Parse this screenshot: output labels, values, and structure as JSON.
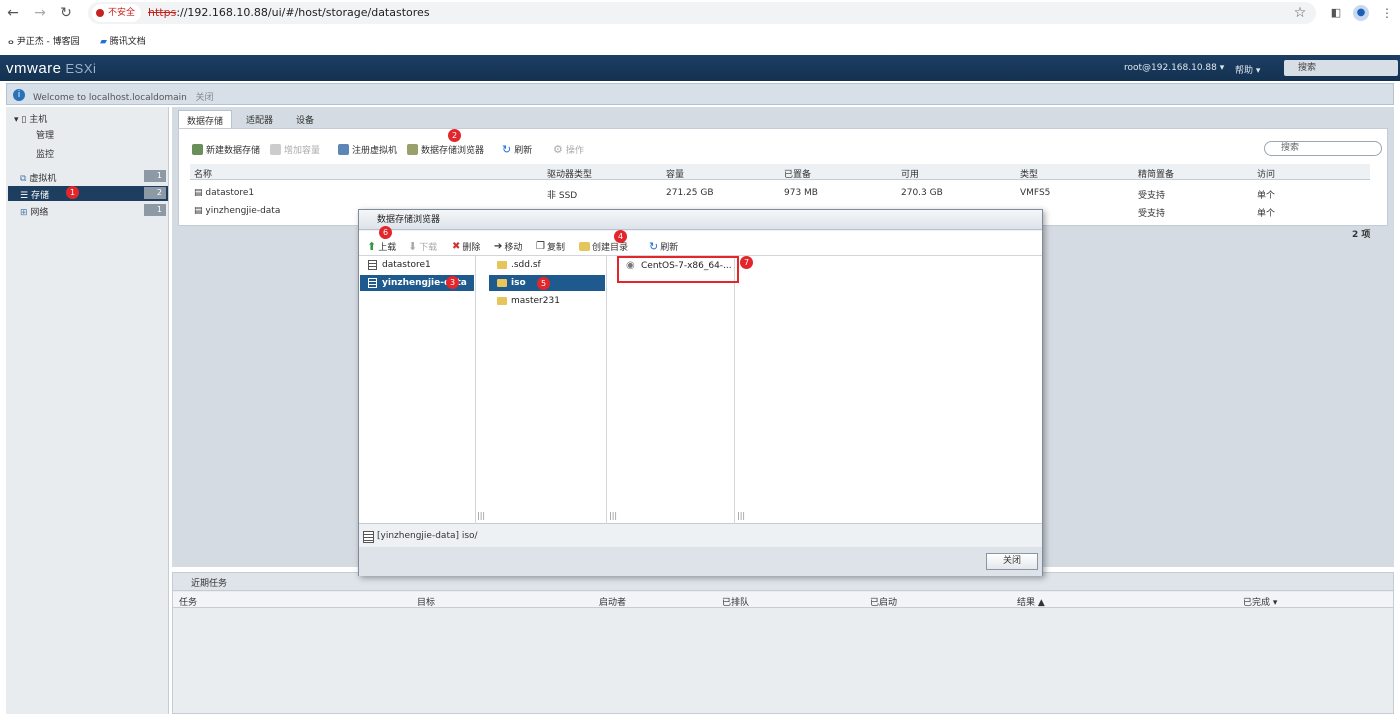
{
  "browser": {
    "insecure_label": "不安全",
    "url_scheme": "https",
    "url_rest": "://192.168.10.88/ui/#/host/storage/datastores",
    "bookmarks": [
      "尹正杰 - 博客园",
      "腾讯文档"
    ]
  },
  "esxi": {
    "logo_brand": "vmware",
    "logo_product": "ESXi",
    "user": "root@192.168.10.88 ▾",
    "help": "帮助 ▾",
    "search_placeholder": "搜索"
  },
  "welcome": {
    "text": "Welcome to localhost.localdomain",
    "dismiss": "关闭"
  },
  "sidebar": {
    "host": "主机",
    "manage": "管理",
    "monitor": "监控",
    "vms": {
      "label": "虚拟机",
      "count": "1"
    },
    "storage": {
      "label": "存储",
      "count": "2"
    },
    "network": {
      "label": "网络",
      "count": "1"
    }
  },
  "main": {
    "tabs": [
      "数据存储",
      "适配器",
      "设备"
    ],
    "toolbar": {
      "new": "新建数据存储",
      "increase": "增加容量",
      "register": "注册虚拟机",
      "browser": "数据存储浏览器",
      "refresh": "刷新",
      "actions": "操作"
    },
    "search_placeholder": "搜索",
    "columns": [
      "名称",
      "驱动器类型",
      "容量",
      "已置备",
      "可用",
      "类型",
      "精简置备",
      "访问"
    ],
    "rows": [
      [
        "datastore1",
        "非 SSD",
        "271.25 GB",
        "973 MB",
        "270.3 GB",
        "VMFS5",
        "受支持",
        "单个"
      ],
      [
        "yinzhengjie-data",
        "非 SSD",
        "",
        "",
        "",
        "VMFS5",
        "受支持",
        "单个"
      ]
    ],
    "items_count": "2 项"
  },
  "tasks": {
    "title": "近期任务",
    "columns": [
      "任务",
      "目标",
      "启动者",
      "已排队",
      "已启动",
      "结果 ▲",
      "已完成 ▾"
    ]
  },
  "dialog": {
    "title": "数据存储浏览器",
    "toolbar": {
      "upload": "上载",
      "download": "下载",
      "delete": "删除",
      "move": "移动",
      "copy": "复制",
      "mkdir": "创建目录",
      "refresh": "刷新"
    },
    "datastores": [
      "datastore1",
      "yinzhengjie-data"
    ],
    "folders": [
      ".sdd.sf",
      "iso",
      "master231"
    ],
    "files": [
      "CentOS-7-x86_64-..."
    ],
    "path": "[yinzhengjie-data] iso/",
    "close": "关闭"
  },
  "badges": [
    "1",
    "2",
    "3",
    "4",
    "5",
    "6",
    "7"
  ]
}
